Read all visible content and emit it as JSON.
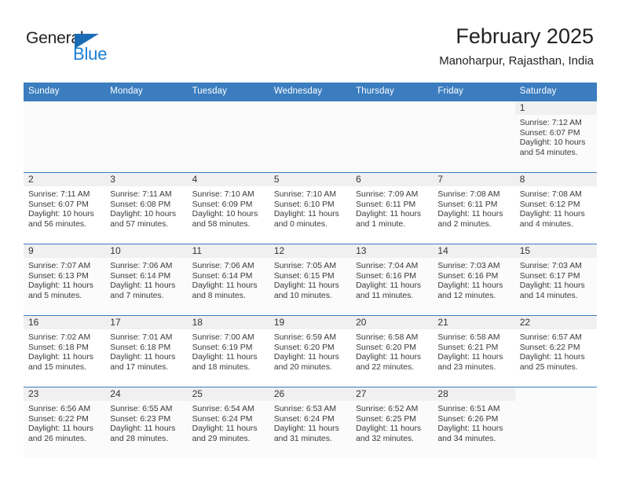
{
  "brand": {
    "word1": "General",
    "word2": "Blue",
    "triangle_color": "#1a6cb5",
    "word2_color": "#1a7fd4"
  },
  "header": {
    "title": "February 2025",
    "subtitle": "Manoharpur, Rajasthan, India"
  },
  "theme": {
    "header_bg": "#3b7dbf",
    "header_text": "#ffffff",
    "daynum_band_bg": "#f0f0f0",
    "row_shaded_bg": "#fbfbfb",
    "grid_line": "#3b7dbf"
  },
  "weekday_headers": [
    "Sunday",
    "Monday",
    "Tuesday",
    "Wednesday",
    "Thursday",
    "Friday",
    "Saturday"
  ],
  "labels": {
    "sunrise_prefix": "Sunrise:",
    "sunset_prefix": "Sunset:",
    "daylight_prefix": "Daylight:"
  },
  "weeks": [
    [
      {
        "day": "",
        "empty": true
      },
      {
        "day": "",
        "empty": true
      },
      {
        "day": "",
        "empty": true
      },
      {
        "day": "",
        "empty": true
      },
      {
        "day": "",
        "empty": true
      },
      {
        "day": "",
        "empty": true
      },
      {
        "day": "1",
        "sunrise": "Sunrise: 7:12 AM",
        "sunset": "Sunset: 6:07 PM",
        "daylight1": "Daylight: 10 hours",
        "daylight2": "and 54 minutes."
      }
    ],
    [
      {
        "day": "2",
        "sunrise": "Sunrise: 7:11 AM",
        "sunset": "Sunset: 6:07 PM",
        "daylight1": "Daylight: 10 hours",
        "daylight2": "and 56 minutes."
      },
      {
        "day": "3",
        "sunrise": "Sunrise: 7:11 AM",
        "sunset": "Sunset: 6:08 PM",
        "daylight1": "Daylight: 10 hours",
        "daylight2": "and 57 minutes."
      },
      {
        "day": "4",
        "sunrise": "Sunrise: 7:10 AM",
        "sunset": "Sunset: 6:09 PM",
        "daylight1": "Daylight: 10 hours",
        "daylight2": "and 58 minutes."
      },
      {
        "day": "5",
        "sunrise": "Sunrise: 7:10 AM",
        "sunset": "Sunset: 6:10 PM",
        "daylight1": "Daylight: 11 hours",
        "daylight2": "and 0 minutes."
      },
      {
        "day": "6",
        "sunrise": "Sunrise: 7:09 AM",
        "sunset": "Sunset: 6:11 PM",
        "daylight1": "Daylight: 11 hours",
        "daylight2": "and 1 minute."
      },
      {
        "day": "7",
        "sunrise": "Sunrise: 7:08 AM",
        "sunset": "Sunset: 6:11 PM",
        "daylight1": "Daylight: 11 hours",
        "daylight2": "and 2 minutes."
      },
      {
        "day": "8",
        "sunrise": "Sunrise: 7:08 AM",
        "sunset": "Sunset: 6:12 PM",
        "daylight1": "Daylight: 11 hours",
        "daylight2": "and 4 minutes."
      }
    ],
    [
      {
        "day": "9",
        "sunrise": "Sunrise: 7:07 AM",
        "sunset": "Sunset: 6:13 PM",
        "daylight1": "Daylight: 11 hours",
        "daylight2": "and 5 minutes."
      },
      {
        "day": "10",
        "sunrise": "Sunrise: 7:06 AM",
        "sunset": "Sunset: 6:14 PM",
        "daylight1": "Daylight: 11 hours",
        "daylight2": "and 7 minutes."
      },
      {
        "day": "11",
        "sunrise": "Sunrise: 7:06 AM",
        "sunset": "Sunset: 6:14 PM",
        "daylight1": "Daylight: 11 hours",
        "daylight2": "and 8 minutes."
      },
      {
        "day": "12",
        "sunrise": "Sunrise: 7:05 AM",
        "sunset": "Sunset: 6:15 PM",
        "daylight1": "Daylight: 11 hours",
        "daylight2": "and 10 minutes."
      },
      {
        "day": "13",
        "sunrise": "Sunrise: 7:04 AM",
        "sunset": "Sunset: 6:16 PM",
        "daylight1": "Daylight: 11 hours",
        "daylight2": "and 11 minutes."
      },
      {
        "day": "14",
        "sunrise": "Sunrise: 7:03 AM",
        "sunset": "Sunset: 6:16 PM",
        "daylight1": "Daylight: 11 hours",
        "daylight2": "and 12 minutes."
      },
      {
        "day": "15",
        "sunrise": "Sunrise: 7:03 AM",
        "sunset": "Sunset: 6:17 PM",
        "daylight1": "Daylight: 11 hours",
        "daylight2": "and 14 minutes."
      }
    ],
    [
      {
        "day": "16",
        "sunrise": "Sunrise: 7:02 AM",
        "sunset": "Sunset: 6:18 PM",
        "daylight1": "Daylight: 11 hours",
        "daylight2": "and 15 minutes."
      },
      {
        "day": "17",
        "sunrise": "Sunrise: 7:01 AM",
        "sunset": "Sunset: 6:18 PM",
        "daylight1": "Daylight: 11 hours",
        "daylight2": "and 17 minutes."
      },
      {
        "day": "18",
        "sunrise": "Sunrise: 7:00 AM",
        "sunset": "Sunset: 6:19 PM",
        "daylight1": "Daylight: 11 hours",
        "daylight2": "and 18 minutes."
      },
      {
        "day": "19",
        "sunrise": "Sunrise: 6:59 AM",
        "sunset": "Sunset: 6:20 PM",
        "daylight1": "Daylight: 11 hours",
        "daylight2": "and 20 minutes."
      },
      {
        "day": "20",
        "sunrise": "Sunrise: 6:58 AM",
        "sunset": "Sunset: 6:20 PM",
        "daylight1": "Daylight: 11 hours",
        "daylight2": "and 22 minutes."
      },
      {
        "day": "21",
        "sunrise": "Sunrise: 6:58 AM",
        "sunset": "Sunset: 6:21 PM",
        "daylight1": "Daylight: 11 hours",
        "daylight2": "and 23 minutes."
      },
      {
        "day": "22",
        "sunrise": "Sunrise: 6:57 AM",
        "sunset": "Sunset: 6:22 PM",
        "daylight1": "Daylight: 11 hours",
        "daylight2": "and 25 minutes."
      }
    ],
    [
      {
        "day": "23",
        "sunrise": "Sunrise: 6:56 AM",
        "sunset": "Sunset: 6:22 PM",
        "daylight1": "Daylight: 11 hours",
        "daylight2": "and 26 minutes."
      },
      {
        "day": "24",
        "sunrise": "Sunrise: 6:55 AM",
        "sunset": "Sunset: 6:23 PM",
        "daylight1": "Daylight: 11 hours",
        "daylight2": "and 28 minutes."
      },
      {
        "day": "25",
        "sunrise": "Sunrise: 6:54 AM",
        "sunset": "Sunset: 6:24 PM",
        "daylight1": "Daylight: 11 hours",
        "daylight2": "and 29 minutes."
      },
      {
        "day": "26",
        "sunrise": "Sunrise: 6:53 AM",
        "sunset": "Sunset: 6:24 PM",
        "daylight1": "Daylight: 11 hours",
        "daylight2": "and 31 minutes."
      },
      {
        "day": "27",
        "sunrise": "Sunrise: 6:52 AM",
        "sunset": "Sunset: 6:25 PM",
        "daylight1": "Daylight: 11 hours",
        "daylight2": "and 32 minutes."
      },
      {
        "day": "28",
        "sunrise": "Sunrise: 6:51 AM",
        "sunset": "Sunset: 6:26 PM",
        "daylight1": "Daylight: 11 hours",
        "daylight2": "and 34 minutes."
      },
      {
        "day": "",
        "empty": true
      }
    ]
  ]
}
